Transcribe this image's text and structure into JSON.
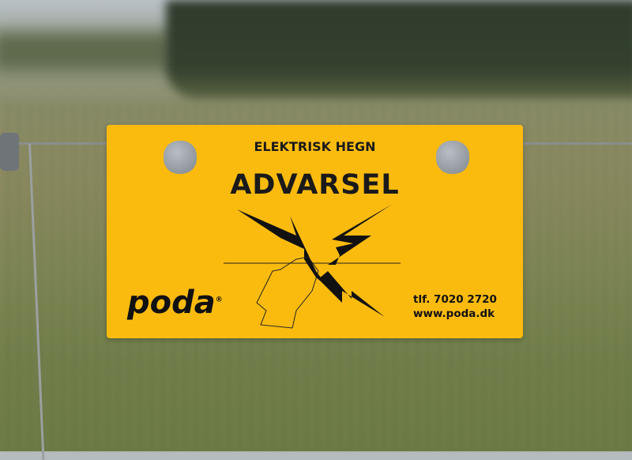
{
  "sign": {
    "heading": "ELEKTRISK HEGN",
    "title": "ADVARSEL",
    "logo": "poda",
    "logo_mark": "®",
    "phone": "tlf. 7020 2720",
    "website": "www.poda.dk",
    "color": "#fbbb0e"
  }
}
